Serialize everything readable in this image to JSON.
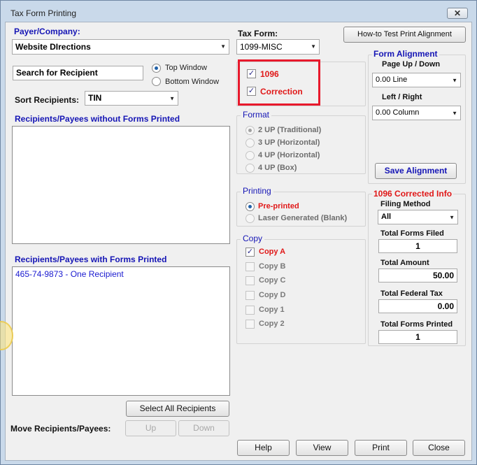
{
  "window": {
    "title": "Tax Form Printing",
    "close_glyph": "✕"
  },
  "payer": {
    "label": "Payer/Company:",
    "value": "Website DIrections"
  },
  "search": {
    "value": "Search for Recipient"
  },
  "window_option": {
    "top_label": "Top Window",
    "bottom_label": "Bottom Window",
    "selected": "top"
  },
  "sort": {
    "label": "Sort Recipients:",
    "value": "TIN"
  },
  "without_forms": {
    "label": "Recipients/Payees without Forms Printed",
    "items": []
  },
  "with_forms": {
    "label": "Recipients/Payees with Forms Printed",
    "items": [
      "465-74-9873 - One Recipient"
    ]
  },
  "select_all": {
    "label": "Select All Recipients"
  },
  "move": {
    "label": "Move Recipients/Payees:",
    "up_label": "Up",
    "down_label": "Down"
  },
  "tax_form": {
    "label": "Tax Form:",
    "value": "1099-MISC"
  },
  "checkbox_1096": {
    "label": "1096",
    "checked": true
  },
  "checkbox_correction": {
    "label": "Correction",
    "checked": true
  },
  "format": {
    "label": "Format",
    "options": [
      {
        "label": "2 UP (Traditional)",
        "selected": true
      },
      {
        "label": "3 UP (Horizontal)",
        "selected": false
      },
      {
        "label": "4 UP (Horizontal)",
        "selected": false
      },
      {
        "label": "4 UP (Box)",
        "selected": false
      }
    ]
  },
  "printing": {
    "label": "Printing",
    "preprinted_label": "Pre-printed",
    "laser_label": "Laser Generated (Blank)",
    "selected": "preprinted"
  },
  "copy": {
    "label": "Copy",
    "items": [
      {
        "label": "Copy A",
        "checked": true
      },
      {
        "label": "Copy B",
        "checked": false
      },
      {
        "label": "Copy C",
        "checked": false
      },
      {
        "label": "Copy D",
        "checked": false
      },
      {
        "label": "Copy 1",
        "checked": false
      },
      {
        "label": "Copy 2",
        "checked": false
      }
    ]
  },
  "test_print": {
    "label": "How-to Test Print  Alignment"
  },
  "alignment": {
    "label": "Form Alignment",
    "page_label": "Page Up / Down",
    "page_value": "0.00 Line",
    "lr_label": "Left / Right",
    "lr_value": "0.00 Column",
    "save_label": "Save  Alignment"
  },
  "corrected_info": {
    "label": "1096 Corrected Info",
    "filing_method_label": "Filing Method",
    "filing_method_value": "All",
    "total_forms_filed_label": "Total Forms Filed",
    "total_forms_filed": "1",
    "total_amount_label": "Total Amount",
    "total_amount": "50.00",
    "total_federal_tax_label": "Total Federal Tax",
    "total_federal_tax": "0.00",
    "total_forms_printed_label": "Total Forms Printed",
    "total_forms_printed": "1"
  },
  "buttons": {
    "help": "Help",
    "view": "View",
    "print": "Print",
    "close": "Close"
  },
  "colors": {
    "accent_blue": "#1515b5",
    "alert_red": "#e01818",
    "highlight_box": "#e8192c"
  }
}
